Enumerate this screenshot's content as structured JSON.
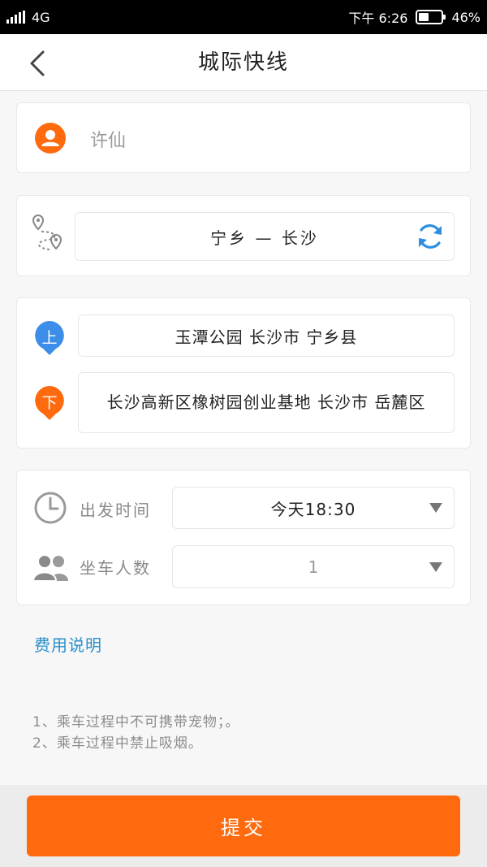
{
  "status_bar": {
    "network": "4G",
    "time": "下午 6:26",
    "battery": "46%",
    "battery_level": 0.46
  },
  "header": {
    "title": "城际快线"
  },
  "passenger": {
    "name": "许仙"
  },
  "route": {
    "text": "宁乡 — 长沙"
  },
  "stops": {
    "pickup_badge": "上",
    "pickup_address": "玉潭公园 长沙市 宁乡县",
    "dropoff_badge": "下",
    "dropoff_address": "长沙高新区橡树园创业基地 长沙市 岳麓区"
  },
  "trip": {
    "departure_label": "出发时间",
    "departure_value": "今天18:30",
    "riders_label": "坐车人数",
    "riders_value": "1"
  },
  "fee_link": "费用说明",
  "notes": [
    "1、乘车过程中不可携带宠物；。",
    "2、乘车过程中禁止吸烟。"
  ],
  "submit_label": "提交",
  "colors": {
    "accent_orange": "#ff6a0e",
    "pickup_blue": "#3d8ee8",
    "link_blue": "#2a8fc9"
  }
}
